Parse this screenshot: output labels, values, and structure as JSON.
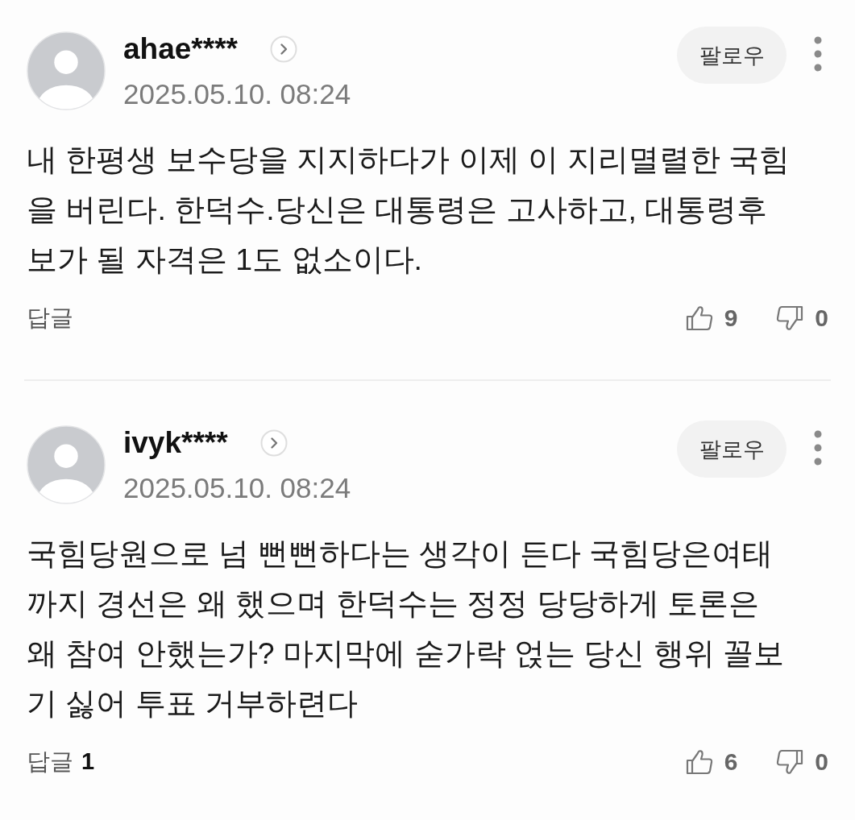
{
  "comments": [
    {
      "username": "ahae****",
      "date": "2025.05.10. 08:24",
      "follow_label": "팔로우",
      "body": "내 한평생 보수당을 지지하다가 이제 이 지리멸렬한 국힘을 버린다. 한덕수.당신은 대통령은 고사하고, 대통령후보가 될 자격은 1도 없소이다.",
      "reply_label": "답글",
      "likes": "9",
      "dislikes": "0"
    },
    {
      "username": "ivyk****",
      "date": "2025.05.10. 08:24",
      "follow_label": "팔로우",
      "body": "국힘당원으로 넘 뻔뻔하다는 생각이 든다 국힘당은여태까지 경선은 왜 했으며 한덕수는 정정 당당하게 토론은 왜 참여 안했는가? 마지막에 숟가락 얹는 당신 행위 꼴보기 싫어 투표 거부하련다",
      "reply_label": "답글",
      "reply_count": "1",
      "likes": "6",
      "dislikes": "0"
    }
  ]
}
